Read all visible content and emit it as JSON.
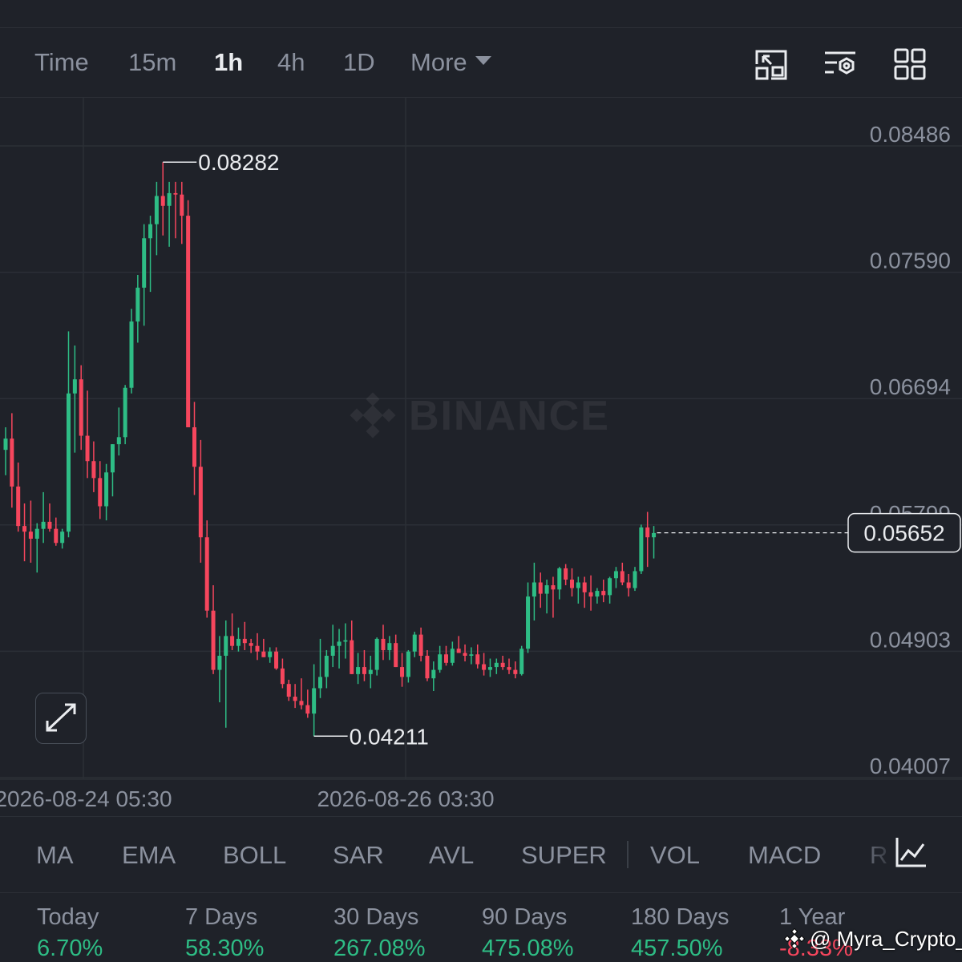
{
  "toolbar": {
    "timeframes": [
      "Time",
      "15m",
      "1h",
      "4h",
      "1D"
    ],
    "active": "1h",
    "more_label": "More",
    "icons": [
      "screen-capture-icon",
      "chart-settings-icon",
      "layout-grid-icon"
    ]
  },
  "watermark": "BINANCE",
  "chart_data": {
    "type": "candlestick",
    "interval": "1h",
    "y_ticks": [
      "0.08486",
      "0.07590",
      "0.06694",
      "0.05799",
      "0.04903",
      "0.04007"
    ],
    "y_range": [
      0.04007,
      0.08486
    ],
    "x_ticks": [
      "2026-08-24 05:30",
      "2026-08-26 03:30"
    ],
    "high_label": "0.08282",
    "low_label": "0.04211",
    "current_price": "0.05652",
    "up_color": "#2ebd85",
    "down_color": "#f6465d",
    "candles": [
      [
        0.0624,
        0.064,
        0.0606,
        0.0632
      ],
      [
        0.0632,
        0.065,
        0.0583,
        0.0598
      ],
      [
        0.0598,
        0.0615,
        0.0566,
        0.057
      ],
      [
        0.057,
        0.0586,
        0.0545,
        0.0566
      ],
      [
        0.0566,
        0.0588,
        0.0544,
        0.0561
      ],
      [
        0.0561,
        0.0572,
        0.0537,
        0.0568
      ],
      [
        0.0568,
        0.0594,
        0.0558,
        0.0573
      ],
      [
        0.0573,
        0.0586,
        0.0566,
        0.0568
      ],
      [
        0.0568,
        0.0576,
        0.0556,
        0.0558
      ],
      [
        0.0558,
        0.0568,
        0.0554,
        0.0566
      ],
      [
        0.0566,
        0.0708,
        0.0562,
        0.0664
      ],
      [
        0.0664,
        0.0698,
        0.0622,
        0.0674
      ],
      [
        0.0674,
        0.0684,
        0.0624,
        0.0634
      ],
      [
        0.0634,
        0.0666,
        0.0604,
        0.0616
      ],
      [
        0.0616,
        0.063,
        0.0594,
        0.0604
      ],
      [
        0.0604,
        0.0616,
        0.0575,
        0.0584
      ],
      [
        0.0584,
        0.0614,
        0.0574,
        0.0608
      ],
      [
        0.0608,
        0.0628,
        0.0591,
        0.0628
      ],
      [
        0.0628,
        0.0654,
        0.062,
        0.0633
      ],
      [
        0.0633,
        0.067,
        0.0628,
        0.0668
      ],
      [
        0.0668,
        0.0724,
        0.0664,
        0.0715
      ],
      [
        0.0715,
        0.0748,
        0.07,
        0.0739
      ],
      [
        0.0739,
        0.0784,
        0.0712,
        0.0774
      ],
      [
        0.0774,
        0.079,
        0.0736,
        0.0784
      ],
      [
        0.0784,
        0.0814,
        0.0762,
        0.0804
      ],
      [
        0.0804,
        0.0828,
        0.0776,
        0.0797
      ],
      [
        0.0797,
        0.0814,
        0.0768,
        0.0806
      ],
      [
        0.0806,
        0.0814,
        0.0774,
        0.0805
      ],
      [
        0.0805,
        0.0814,
        0.077,
        0.079
      ],
      [
        0.079,
        0.0801,
        0.07,
        0.064
      ],
      [
        0.064,
        0.0658,
        0.0592,
        0.0612
      ],
      [
        0.0612,
        0.0631,
        0.0544,
        0.0562
      ],
      [
        0.0562,
        0.0574,
        0.0505,
        0.051
      ],
      [
        0.051,
        0.0528,
        0.0465,
        0.0468
      ],
      [
        0.0468,
        0.0492,
        0.0445,
        0.0478
      ],
      [
        0.0478,
        0.0503,
        0.0427,
        0.0492
      ],
      [
        0.0492,
        0.0508,
        0.0482,
        0.0485
      ],
      [
        0.0485,
        0.0498,
        0.0481,
        0.049
      ],
      [
        0.049,
        0.0502,
        0.0482,
        0.0487
      ],
      [
        0.0487,
        0.049,
        0.048,
        0.0485
      ],
      [
        0.0485,
        0.0494,
        0.0475,
        0.0481
      ],
      [
        0.0481,
        0.049,
        0.0477,
        0.0477
      ],
      [
        0.0477,
        0.0484,
        0.0473,
        0.0481
      ],
      [
        0.0481,
        0.0484,
        0.0468,
        0.0469
      ],
      [
        0.0469,
        0.0476,
        0.0455,
        0.0458
      ],
      [
        0.0458,
        0.0461,
        0.0446,
        0.0449
      ],
      [
        0.0449,
        0.0458,
        0.0441,
        0.0446
      ],
      [
        0.0446,
        0.0462,
        0.044,
        0.0443
      ],
      [
        0.0443,
        0.0454,
        0.0434,
        0.0437
      ],
      [
        0.0437,
        0.0472,
        0.0421,
        0.0455
      ],
      [
        0.0455,
        0.049,
        0.0448,
        0.0463
      ],
      [
        0.0463,
        0.0482,
        0.0455,
        0.0478
      ],
      [
        0.0478,
        0.05,
        0.047,
        0.0485
      ],
      [
        0.0485,
        0.0497,
        0.0469,
        0.0488
      ],
      [
        0.0488,
        0.0501,
        0.0476,
        0.0489
      ],
      [
        0.0489,
        0.0503,
        0.0465,
        0.0465
      ],
      [
        0.0465,
        0.048,
        0.0458,
        0.047
      ],
      [
        0.047,
        0.0482,
        0.046,
        0.0465
      ],
      [
        0.0465,
        0.0478,
        0.0455,
        0.0468
      ],
      [
        0.0468,
        0.0491,
        0.0464,
        0.049
      ],
      [
        0.049,
        0.05,
        0.0475,
        0.0482
      ],
      [
        0.0482,
        0.0492,
        0.0475,
        0.0487
      ],
      [
        0.0487,
        0.0493,
        0.047,
        0.047
      ],
      [
        0.047,
        0.048,
        0.0456,
        0.0463
      ],
      [
        0.0463,
        0.0482,
        0.0459,
        0.0481
      ],
      [
        0.0481,
        0.0495,
        0.0477,
        0.0493
      ],
      [
        0.0493,
        0.0498,
        0.0474,
        0.0478
      ],
      [
        0.0478,
        0.0482,
        0.046,
        0.0462
      ],
      [
        0.0462,
        0.0474,
        0.0453,
        0.0468
      ],
      [
        0.0468,
        0.0485,
        0.0466,
        0.0479
      ],
      [
        0.0479,
        0.0485,
        0.0471,
        0.0473
      ],
      [
        0.0473,
        0.0488,
        0.0471,
        0.0483
      ],
      [
        0.0483,
        0.0492,
        0.048,
        0.048
      ],
      [
        0.048,
        0.0486,
        0.0474,
        0.0478
      ],
      [
        0.0478,
        0.0484,
        0.0472,
        0.0479
      ],
      [
        0.0479,
        0.0486,
        0.0469,
        0.0472
      ],
      [
        0.0472,
        0.048,
        0.0464,
        0.0468
      ],
      [
        0.0468,
        0.0476,
        0.0463,
        0.047
      ],
      [
        0.047,
        0.0476,
        0.0465,
        0.0473
      ],
      [
        0.0473,
        0.0478,
        0.0468,
        0.047
      ],
      [
        0.047,
        0.0476,
        0.0465,
        0.0468
      ],
      [
        0.0468,
        0.0474,
        0.0462,
        0.0465
      ],
      [
        0.0465,
        0.0485,
        0.0464,
        0.0483
      ],
      [
        0.0483,
        0.053,
        0.048,
        0.052
      ],
      [
        0.052,
        0.0544,
        0.0503,
        0.053
      ],
      [
        0.053,
        0.0537,
        0.0512,
        0.0522
      ],
      [
        0.0522,
        0.0532,
        0.0508,
        0.0528
      ],
      [
        0.0528,
        0.0534,
        0.0505,
        0.0525
      ],
      [
        0.0525,
        0.0541,
        0.0518,
        0.054
      ],
      [
        0.054,
        0.0543,
        0.0528,
        0.0532
      ],
      [
        0.0532,
        0.054,
        0.052,
        0.0526
      ],
      [
        0.0526,
        0.0534,
        0.0515,
        0.053
      ],
      [
        0.053,
        0.0534,
        0.0512,
        0.0523
      ],
      [
        0.0523,
        0.0535,
        0.051,
        0.052
      ],
      [
        0.052,
        0.0526,
        0.0515,
        0.0524
      ],
      [
        0.0524,
        0.0532,
        0.0516,
        0.0521
      ],
      [
        0.0521,
        0.0534,
        0.0515,
        0.0533
      ],
      [
        0.0533,
        0.0541,
        0.0526,
        0.0538
      ],
      [
        0.0538,
        0.0544,
        0.0528,
        0.053
      ],
      [
        0.053,
        0.0536,
        0.052,
        0.0526
      ],
      [
        0.0526,
        0.0541,
        0.0524,
        0.0538
      ],
      [
        0.0538,
        0.0571,
        0.0536,
        0.0569
      ],
      [
        0.0569,
        0.058,
        0.0541,
        0.0562
      ],
      [
        0.0562,
        0.057,
        0.0547,
        0.0565
      ]
    ]
  },
  "expand_icon": "expand-arrows-icon",
  "indicators": {
    "items": [
      "MA",
      "EMA",
      "BOLL",
      "SAR",
      "AVL",
      "SUPER",
      "VOL",
      "MACD",
      "R"
    ],
    "end_icon": "indicator-chart-icon"
  },
  "performance": [
    {
      "label": "Today",
      "value": "6.70%",
      "trend": "up"
    },
    {
      "label": "7 Days",
      "value": "58.30%",
      "trend": "up"
    },
    {
      "label": "30 Days",
      "value": "267.08%",
      "trend": "up"
    },
    {
      "label": "90 Days",
      "value": "475.08%",
      "trend": "up"
    },
    {
      "label": "180 Days",
      "value": "457.50%",
      "trend": "up"
    },
    {
      "label": "1 Year",
      "value": "-8.33%",
      "trend": "down"
    }
  ],
  "user_watermark": "@ Myra_Crypto_"
}
